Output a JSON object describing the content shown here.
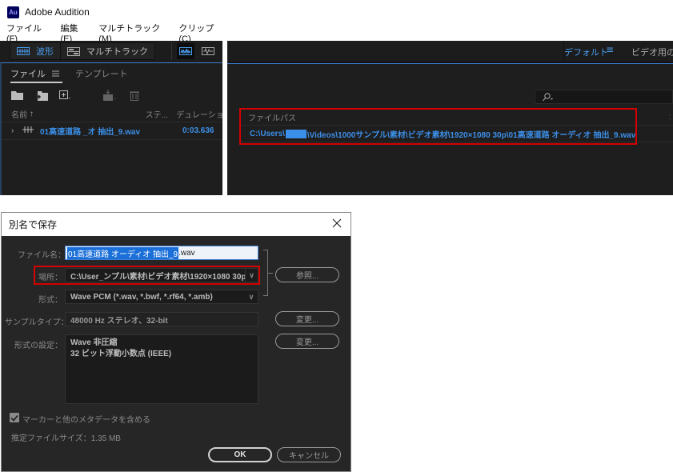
{
  "app": {
    "title": "Adobe Audition",
    "logo": "Au",
    "menu": [
      "ファイル(F)",
      "編集(E)",
      "マルチトラック(M)",
      "クリップ(C)"
    ]
  },
  "toolbar": {
    "waveform_label": "波形",
    "multitrack_label": "マルチトラック",
    "workspace_default": "デフォルト",
    "workspace_menu_icon": "hamburger-icon",
    "workspace_video": "ビデオ用のオ"
  },
  "files_panel": {
    "tabs": [
      {
        "label": "ファイル",
        "active": true
      },
      {
        "label": "テンプレート",
        "active": false
      }
    ],
    "icons": [
      "open-folder-icon",
      "import-icon",
      "new-file-icon",
      "insert-into-multitrack-icon",
      "delete-icon"
    ],
    "columns": {
      "name": "名前",
      "status": "ステ...",
      "duration": "デュレーション...",
      "path": "ファイルパス"
    },
    "rows": [
      {
        "name": "01高速道路 _オ 抽出_9.wav",
        "duration": "0:03.636",
        "path_prefix": "C:\\Users\\",
        "path_suffix": "\\Videos\\1000サンプル\\素材\\ビデオ素材\\1920×1080 30p\\01高速道路 オーディオ 抽出_9.wav"
      }
    ],
    "search_placeholder": ""
  },
  "dialog": {
    "title": "別名で保存",
    "filename_label": "ファイル名：",
    "filename_selected": "01高速道路 オーディオ 抽出_9",
    "filename_ext": ".wav",
    "location_label": "場所：",
    "location_value": "C:\\User_ンプル\\素材\\ビデオ素材\\1920×1080 30p",
    "browse_label": "参照...",
    "format_label": "形式：",
    "format_value": "Wave PCM (*.wav, *.bwf, *.rf64, *.amb)",
    "sample_type_label": "サンプルタイプ：",
    "sample_type_value": "48000 Hz ステレオ、32-bit",
    "change_label": "変更...",
    "format_settings_label": "形式の設定：",
    "format_settings_lines": [
      "Wave 非圧縮",
      "32 ビット浮動小数点 (IEEE)"
    ],
    "include_markers_label": "マーカーと他のメタデータを含める",
    "include_markers_checked": true,
    "estimated_size_label": "推定ファイルサイズ：1.35 MB",
    "ok_label": "OK",
    "cancel_label": "キャンセル"
  },
  "colors": {
    "accent_blue": "#3c8fe8",
    "highlight_red": "#d40000",
    "panel_bg": "#1e1e1e"
  }
}
